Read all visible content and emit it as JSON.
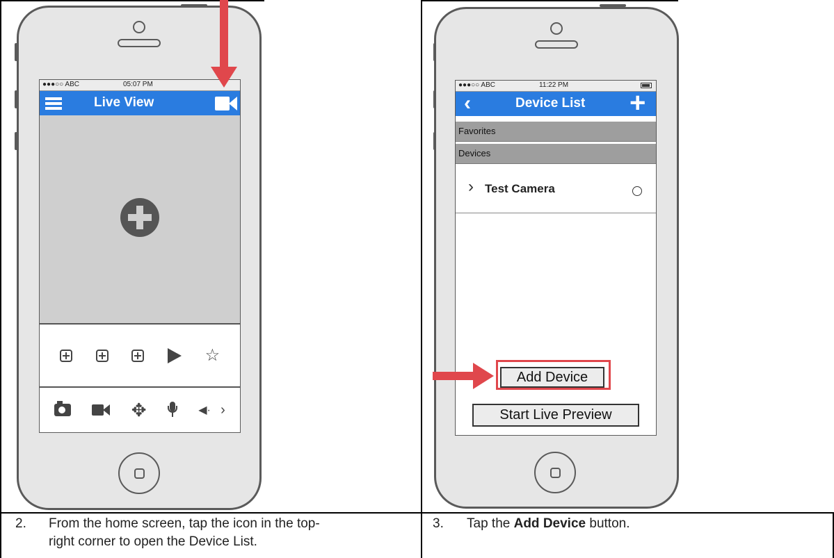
{
  "left_phone": {
    "status": {
      "carrier": "●●●○○ ABC",
      "time": "05:07 PM"
    },
    "nav": {
      "title": "Live View"
    },
    "toolbar_icons": [
      "add-split-1-icon",
      "add-split-2-icon",
      "add-split-3-icon",
      "play-icon",
      "star-icon"
    ],
    "bottom_icons": [
      "camera-icon",
      "video-icon",
      "move-icon",
      "mic-icon",
      "speaker-icon",
      "chevron-right-icon"
    ],
    "glyphs": {
      "star": "☆",
      "move": "✥",
      "speaker": "◀·",
      "chevron": "›"
    }
  },
  "right_phone": {
    "status": {
      "carrier": "●●●○○ ABC",
      "time": "11:22 PM"
    },
    "nav": {
      "back": "‹",
      "title": "Device List",
      "add": "+"
    },
    "sections": {
      "favorites": "Favorites",
      "devices": "Devices"
    },
    "devices": [
      {
        "name": "Test Camera",
        "chevron": "›"
      }
    ],
    "buttons": {
      "add_device": "Add Device",
      "start_preview": "Start Live Preview"
    }
  },
  "captions": {
    "step2_number": "2.",
    "step2_line1": "From the home screen, tap the icon in the top-",
    "step2_line2": "right corner to open the Device List.",
    "step3_number": "3.",
    "step3_pre": "Tap the ",
    "step3_bold": "Add Device",
    "step3_post": " button."
  },
  "colors": {
    "accent": "#2a7ce0",
    "arrow": "#e0474c"
  }
}
